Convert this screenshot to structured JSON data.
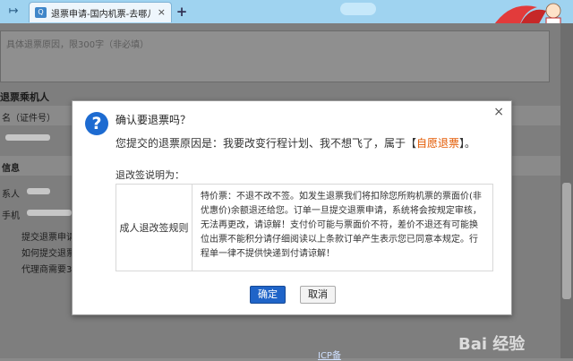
{
  "browser": {
    "tab_icon": "tab-favicon",
    "tab_title": "退票申请-国内机票-去哪儿",
    "tab_close": "×",
    "new_tab": "+",
    "back_glyph": "↦"
  },
  "page": {
    "textbox_placeholder": "具体退票原因，限300字（非必填）",
    "passenger_section": "退票乘机人",
    "name_col": "名（证件号）",
    "contact_section": "信息",
    "contact_label": "系人",
    "phone_label": "手机",
    "tips": [
      "提交退票申请",
      "如何提交退票",
      "代理商需要3"
    ],
    "footer_link": "ICP备"
  },
  "dialog": {
    "title": "确认要退票吗？",
    "reason_prefix": "您提交的退票原因是：我要改变行程计划、我不想飞了，属于【",
    "reason_highlight": "自愿退票",
    "reason_suffix": "】。",
    "rules_heading": "退改签说明为：",
    "rules_label": "成人退改签规则",
    "rules_text": "特价票：不退不改不签。如发生退票我们将扣除您所购机票的票面价(非优惠价)余额退还给您。订单一旦提交退票申请，系统将会按规定审核，无法再更改，请谅解！支付价可能与票面价不符，差价不退还有可能换位出票不能积分请仔细阅读以上条款订单产生表示您已同意本规定。行程单一律不提供快递到付请谅解！",
    "ok_label": "确定",
    "cancel_label": "取消",
    "close_glyph": "×",
    "question_glyph": "?"
  },
  "colors": {
    "highlight": "#e35900",
    "primary_button": "#1f64c8",
    "question_icon": "#1d6bd1"
  },
  "watermark": "Bai 经验"
}
